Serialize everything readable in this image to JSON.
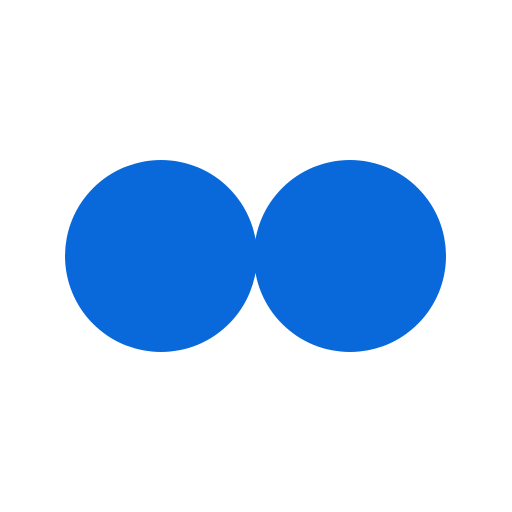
{
  "logo": {
    "icon": "two-overlapping-circles-icon",
    "colors": {
      "circle_fill": "#0A69DA",
      "background": "#FFFFFF"
    }
  }
}
